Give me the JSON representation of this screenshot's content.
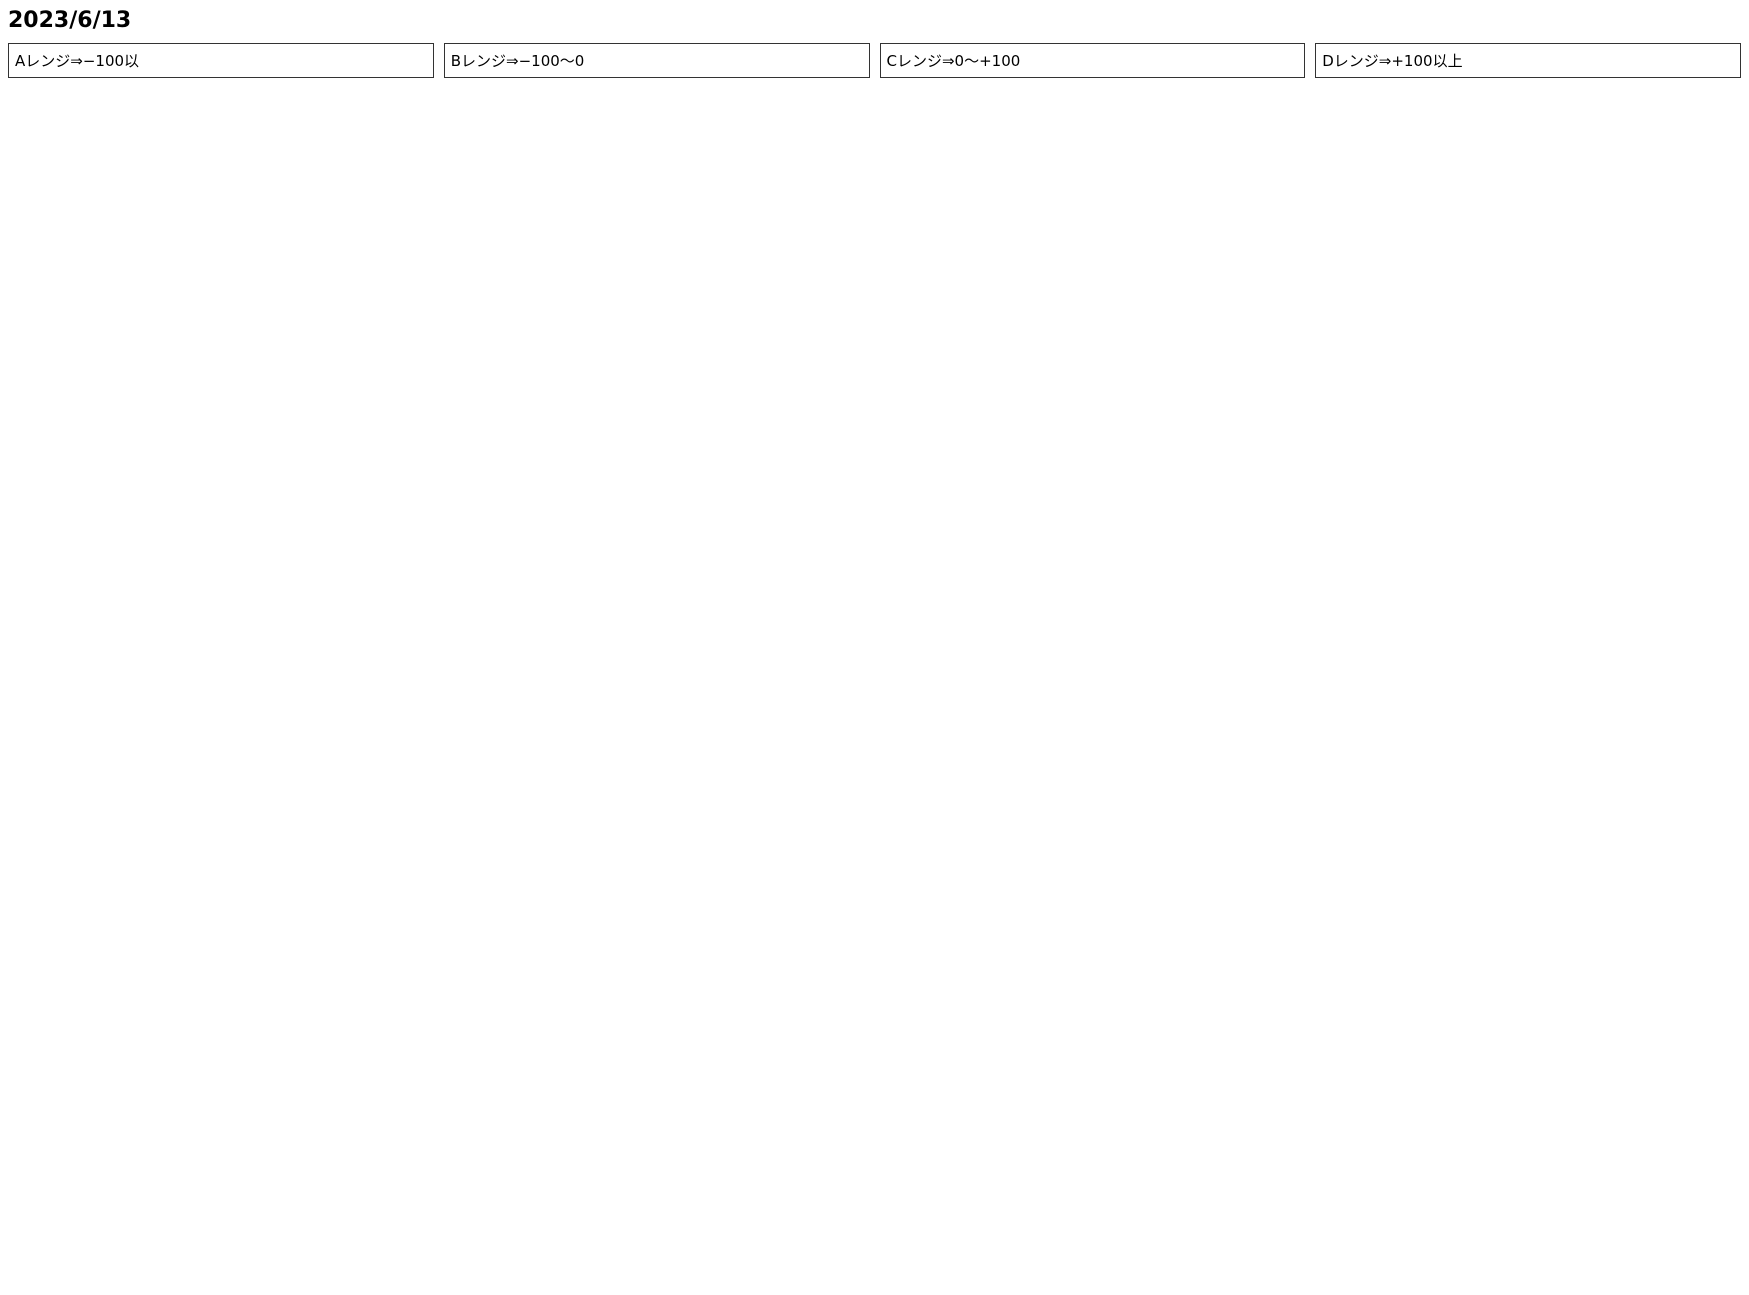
{
  "date": "2023/6/13",
  "ranges": [
    "Aレンジ⇒−100以",
    "Bレンジ⇒−100〜0",
    "Cレンジ⇒0〜+100",
    "Dレンジ⇒+100以上"
  ]
}
